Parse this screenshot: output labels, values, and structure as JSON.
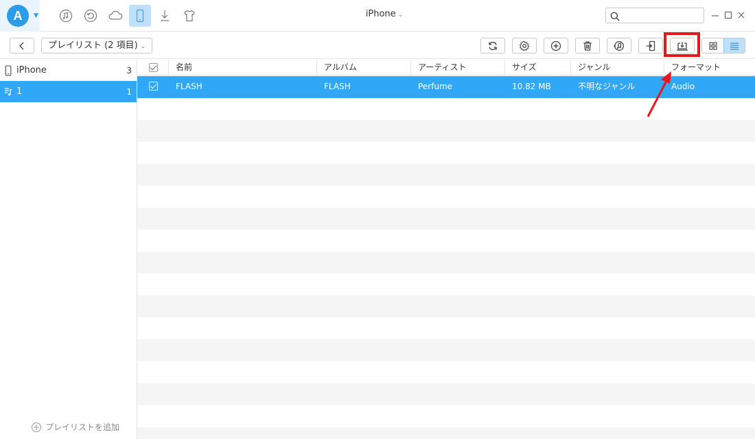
{
  "window": {
    "device_title": "iPhone"
  },
  "titlebar": {
    "logo_letter": "A",
    "nav": [
      {
        "name": "music-icon"
      },
      {
        "name": "restore-icon"
      },
      {
        "name": "cloud-icon"
      },
      {
        "name": "phone-icon",
        "active": true
      },
      {
        "name": "download-icon"
      },
      {
        "name": "shirt-icon"
      }
    ],
    "search": {
      "placeholder": "",
      "value": ""
    }
  },
  "toolbar": {
    "breadcrumb": "プレイリスト (2 項目)",
    "buttons": [
      "refresh-icon",
      "settings-icon",
      "add-icon",
      "delete-icon",
      "to-itunes-icon",
      "to-device-icon",
      "to-computer-icon"
    ],
    "view_modes": [
      "grid-view-icon",
      "list-view-icon"
    ],
    "active_view": "list-view-icon"
  },
  "sidebar": {
    "items": [
      {
        "label": "iPhone",
        "count": "3",
        "icon": "phone-icon",
        "selected": false
      },
      {
        "label": "1",
        "count": "1",
        "icon": "playlist-icon",
        "selected": true
      }
    ],
    "add_playlist_label": "プレイリストを追加"
  },
  "table": {
    "columns": [
      "名前",
      "アルバム",
      "アーティスト",
      "サイズ",
      "ジャンル",
      "フォーマット"
    ],
    "rows": [
      {
        "name": "FLASH",
        "album": "FLASH",
        "artist": "Perfume",
        "size": "10.82 MB",
        "genre": "不明なジャンル",
        "format": "Audio",
        "checked": true,
        "selected": true
      }
    ]
  },
  "colors": {
    "accent": "#31a7f7",
    "highlight": "#e8161c",
    "nav_active": "#bfe0fb"
  }
}
